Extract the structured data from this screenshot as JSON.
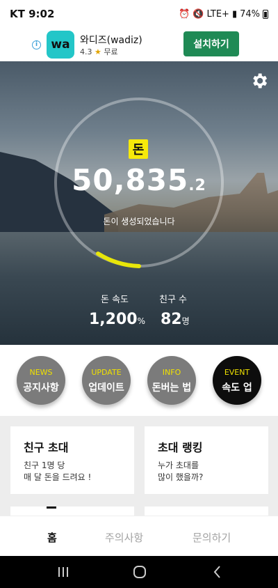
{
  "status_bar": {
    "carrier_time": "KT 9:02",
    "network": "LTE+",
    "battery": "74%"
  },
  "ad": {
    "logo_text": "wa",
    "app_name": "와디즈(wadiz)",
    "rating": "4.3",
    "price": "무료",
    "install_label": "설치하기",
    "info_icon": "info-icon"
  },
  "hero": {
    "currency_badge": "돈",
    "money_integer": "50,835",
    "money_decimal": ".2",
    "money_status": "돈이 생성되었습니다",
    "speed_label": "돈 속도",
    "speed_value": "1,200",
    "speed_unit": "%",
    "friends_label": "친구 수",
    "friends_value": "82",
    "friends_unit": "명",
    "progress_accent": "#e8e60a",
    "settings_icon": "gear-icon"
  },
  "menu": [
    {
      "en": "NEWS",
      "ko": "공지사항"
    },
    {
      "en": "UPDATE",
      "ko": "업데이트"
    },
    {
      "en": "INFO",
      "ko": "돈버는 법"
    },
    {
      "en": "EVENT",
      "ko": "속도 업"
    }
  ],
  "cards": [
    {
      "title": "친구 초대",
      "desc_line1": "친구 1명 당",
      "desc_line2": "매 달 돈을 드려요 !"
    },
    {
      "title": "초대 랭킹",
      "desc_line1": "누가 초대를",
      "desc_line2": "많이 했을까?"
    }
  ],
  "bottom_nav": {
    "home": "홈",
    "notice": "주의사항",
    "inquiry": "문의하기"
  },
  "colors": {
    "accent_yellow": "#f7ea0a",
    "install_green": "#1f8a55",
    "menu_gray": "#7b7b7b",
    "menu_dark": "#0d0d0d"
  }
}
